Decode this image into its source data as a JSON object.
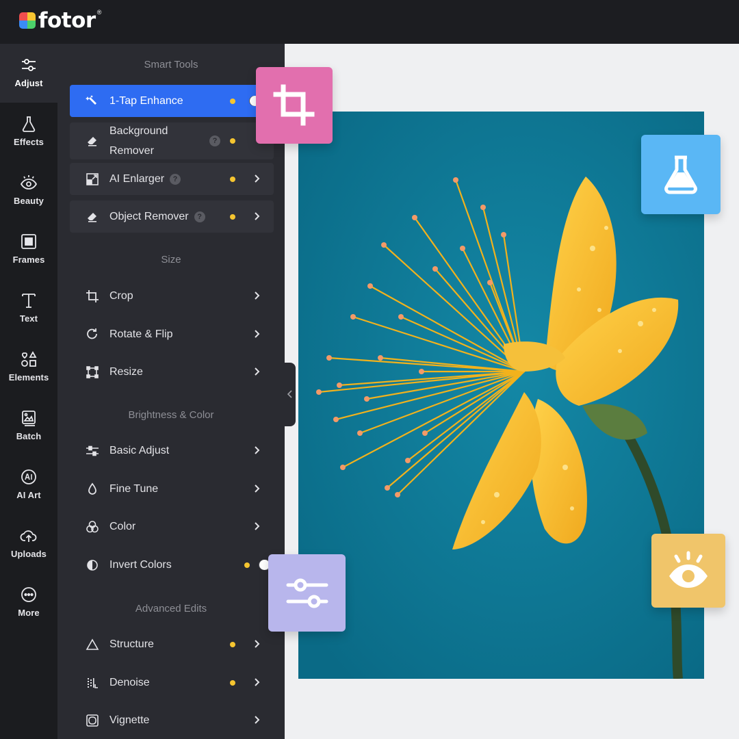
{
  "app": {
    "logo_text": "fotor",
    "registered_mark": "®"
  },
  "rail": {
    "items": [
      {
        "label": "Adjust",
        "icon": "sliders-icon",
        "active": true
      },
      {
        "label": "Effects",
        "icon": "flask-icon"
      },
      {
        "label": "Beauty",
        "icon": "eye-icon"
      },
      {
        "label": "Frames",
        "icon": "frame-icon"
      },
      {
        "label": "Text",
        "icon": "text-icon"
      },
      {
        "label": "Elements",
        "icon": "elements-icon"
      },
      {
        "label": "Batch",
        "icon": "batch-icon"
      },
      {
        "label": "AI Art",
        "icon": "ai-art-icon"
      },
      {
        "label": "Uploads",
        "icon": "cloud-upload-icon"
      },
      {
        "label": "More",
        "icon": "more-icon"
      }
    ]
  },
  "panel": {
    "sections": {
      "smart_tools": "Smart Tools",
      "size": "Size",
      "brightness_color": "Brightness & Color",
      "advanced_edits": "Advanced Edits"
    },
    "tools": {
      "one_tap_enhance": "1-Tap Enhance",
      "background_remover_line1": "Background",
      "background_remover_line2": "Remover",
      "ai_enlarger": "AI Enlarger",
      "object_remover": "Object Remover",
      "crop": "Crop",
      "rotate_flip": "Rotate & Flip",
      "resize": "Resize",
      "basic_adjust": "Basic Adjust",
      "fine_tune": "Fine Tune",
      "color": "Color",
      "invert_colors": "Invert Colors",
      "structure": "Structure",
      "denoise": "Denoise",
      "vignette": "Vignette"
    },
    "help_glyph": "?"
  },
  "colors": {
    "accent_blue": "#2e6cf2",
    "premium_dot": "#f5c530",
    "crop_tile": "#e26fae",
    "flask_tile": "#5ab7f5",
    "sliders_tile": "#b8b6ec",
    "eye_tile": "#f0c56a",
    "photo_background": "#0f7a99"
  }
}
